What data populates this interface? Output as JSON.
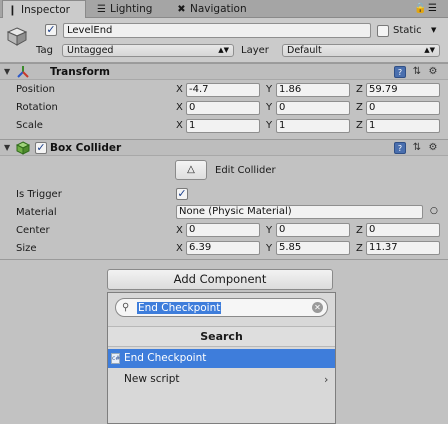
{
  "tabs": [
    {
      "label": "Inspector",
      "icon": "info-icon"
    },
    {
      "label": "Lighting",
      "icon": "lighting-icon"
    },
    {
      "label": "Navigation",
      "icon": "navigation-icon"
    }
  ],
  "header": {
    "object_name": "LevelEnd",
    "static_label": "Static",
    "tag_label": "Tag",
    "tag_value": "Untagged",
    "layer_label": "Layer",
    "layer_value": "Default",
    "active": true,
    "static": false
  },
  "transform": {
    "title": "Transform",
    "rows": [
      {
        "label": "Position",
        "x": "-4.7",
        "y": "1.86",
        "z": "59.79"
      },
      {
        "label": "Rotation",
        "x": "0",
        "y": "0",
        "z": "0"
      },
      {
        "label": "Scale",
        "x": "1",
        "y": "1",
        "z": "1"
      }
    ]
  },
  "box_collider": {
    "title": "Box Collider",
    "enabled": true,
    "edit_collider_label": "Edit Collider",
    "is_trigger_label": "Is Trigger",
    "is_trigger": true,
    "material_label": "Material",
    "material_value": "None (Physic Material)",
    "center_label": "Center",
    "center": {
      "x": "0",
      "y": "0",
      "z": "0"
    },
    "size_label": "Size",
    "size": {
      "x": "6.39",
      "y": "5.85",
      "z": "11.37"
    }
  },
  "axes": {
    "x": "X",
    "y": "Y",
    "z": "Z"
  },
  "add_component": {
    "button_label": "Add Component",
    "search_value": "End Checkpoint",
    "section_title": "Search",
    "results": [
      "End Checkpoint",
      "New script"
    ]
  },
  "colors": {
    "selection": "#3e7ddb",
    "panel": "#c2c2c2",
    "tabbar": "#a5a5a5"
  }
}
